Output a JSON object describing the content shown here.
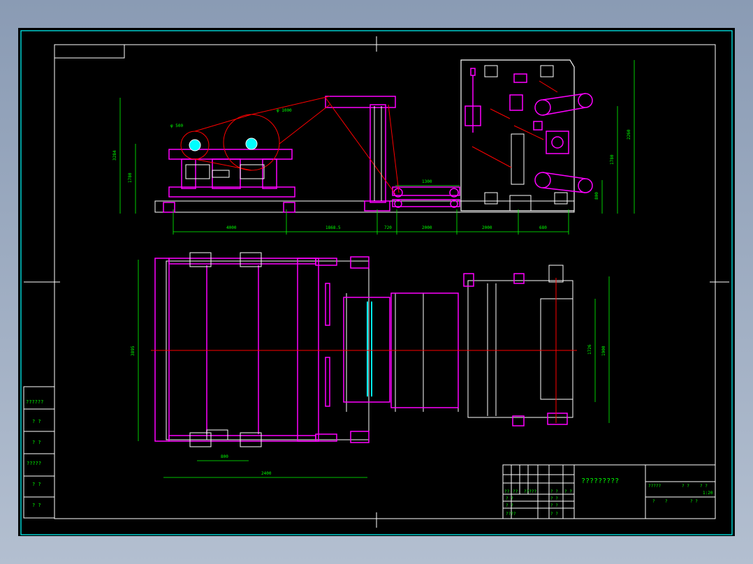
{
  "colors": {
    "background": "#000000",
    "frame": "#ffffff",
    "outer_border": "#00ffff",
    "machine": "#ff00ff",
    "centerline": "#ff0000",
    "dimension": "#00ff00",
    "detail": "#ffffff",
    "tables": "#00ff00"
  },
  "drawing": {
    "title": "?????????",
    "side_view": {
      "dims_bottom": [
        "4000",
        "1868.5",
        "720",
        "2000",
        "2000",
        "680"
      ],
      "dims_left": [
        "3284",
        "1780"
      ],
      "dims_right": [
        "2260",
        "1780",
        "800"
      ],
      "roll_labels": [
        "φ 500",
        "φ 1000"
      ],
      "top_dim": "1300"
    },
    "plan_view": {
      "dim_left": "3895",
      "dim_bottom_small": "800",
      "dim_bottom_long": "2400",
      "dims_right": [
        "1726",
        "1900"
      ]
    }
  },
  "left_strip": {
    "cells": [
      "??????",
      "? ?",
      "? ?",
      "?????",
      "? ?",
      "? ?"
    ]
  },
  "title_block": {
    "rev_row": [
      "??",
      "??",
      "?????",
      "? ?",
      "? ?"
    ],
    "sign_rows": [
      [
        "? ?",
        "",
        "? ?"
      ],
      [
        "? ?",
        "",
        "? ?"
      ],
      [
        "????",
        "",
        "? ?"
      ]
    ],
    "right_top": [
      "?????",
      "? ?",
      "? ?"
    ],
    "right_bottom": [
      "?",
      "?",
      "? ?",
      "1:20"
    ]
  }
}
